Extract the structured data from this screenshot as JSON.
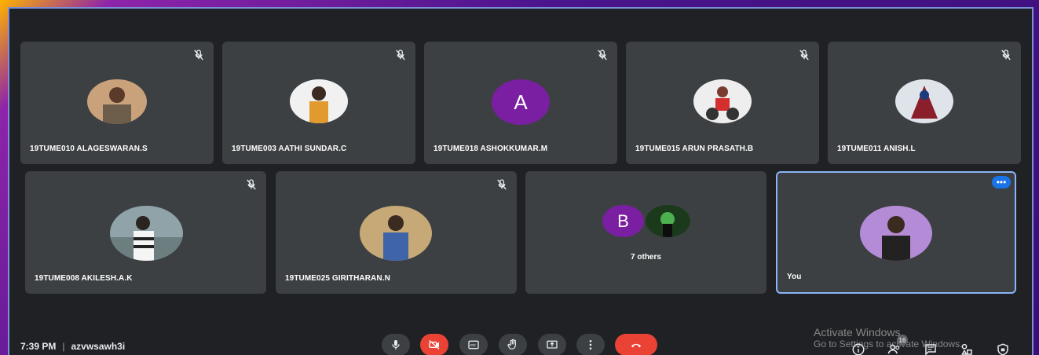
{
  "participants": [
    {
      "name": "19TUME010 ALAGESWARAN.S"
    },
    {
      "name": "19TUME003 AATHI SUNDAR.C"
    },
    {
      "name": "19TUME018 ASHOKKUMAR.M",
      "initial": "A"
    },
    {
      "name": "19TUME015 ARUN PRASATH.B"
    },
    {
      "name": "19TUME011 ANISH.L"
    },
    {
      "name": "19TUME008 AKILESH.A.K"
    },
    {
      "name": "19TUME025 GIRITHARAN.N"
    }
  ],
  "others": {
    "initial": "B",
    "label": "7 others"
  },
  "self": {
    "label": "You"
  },
  "meeting": {
    "time": "7:39 PM",
    "separator": "|",
    "code": "azvwsawh3i"
  },
  "people_count": "16",
  "watermark": {
    "line1": "Activate Windows",
    "line2": "Go to Settings to activate Windows."
  },
  "colors": {
    "tile": "#3c4043",
    "background": "#202124",
    "accent": "#8ab4f8",
    "danger": "#ea4335",
    "avatar_purple": "#7b1fa2"
  }
}
